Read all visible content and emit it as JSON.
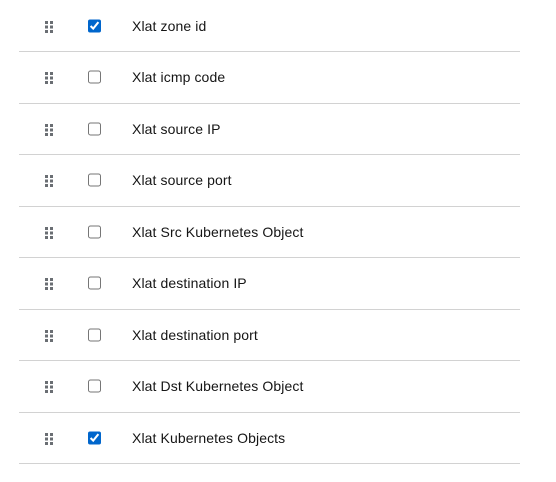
{
  "columns": [
    {
      "label": "Xlat zone id",
      "checked": true
    },
    {
      "label": "Xlat icmp code",
      "checked": false
    },
    {
      "label": "Xlat source IP",
      "checked": false
    },
    {
      "label": "Xlat source port",
      "checked": false
    },
    {
      "label": "Xlat Src Kubernetes Object",
      "checked": false
    },
    {
      "label": "Xlat destination IP",
      "checked": false
    },
    {
      "label": "Xlat destination port",
      "checked": false
    },
    {
      "label": "Xlat Dst Kubernetes Object",
      "checked": false
    },
    {
      "label": "Xlat Kubernetes Objects",
      "checked": true
    }
  ],
  "icons": {
    "drag": "grip-vertical-icon"
  },
  "colors": {
    "divider": "#d2d2d2",
    "text": "#151515",
    "drag_icon": "#6a6e73",
    "checkbox_accent": "#0066cc"
  }
}
